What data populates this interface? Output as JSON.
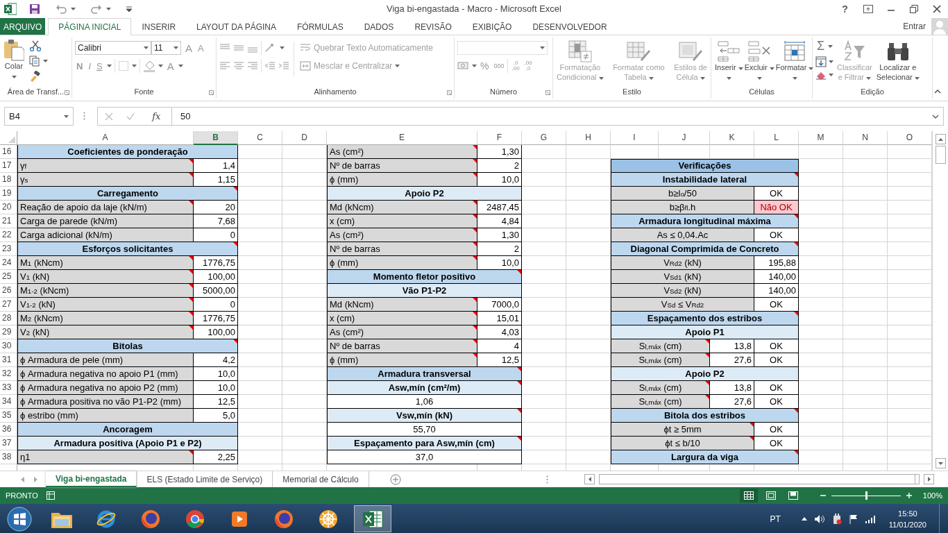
{
  "window": {
    "title": "Viga bi-engastada - Macro - Microsoft Excel",
    "help": "?"
  },
  "tabs": [
    {
      "label": "ARQUIVO",
      "kind": "file",
      "selected": false
    },
    {
      "label": "PÁGINA INICIAL",
      "kind": "tab",
      "selected": true
    },
    {
      "label": "INSERIR",
      "kind": "tab",
      "selected": false
    },
    {
      "label": "LAYOUT DA PÁGINA",
      "kind": "tab",
      "selected": false
    },
    {
      "label": "FÓRMULAS",
      "kind": "tab",
      "selected": false
    },
    {
      "label": "DADOS",
      "kind": "tab",
      "selected": false
    },
    {
      "label": "REVISÃO",
      "kind": "tab",
      "selected": false
    },
    {
      "label": "EXIBIÇÃO",
      "kind": "tab",
      "selected": false
    },
    {
      "label": "DESENVOLVEDOR",
      "kind": "tab",
      "selected": false
    }
  ],
  "account": {
    "label": "Entrar"
  },
  "ribbon": {
    "clipboard": {
      "name": "Área de Transf...",
      "paste": "Colar"
    },
    "font": {
      "name": "Fonte",
      "family": "Calibri",
      "size": "11",
      "grow": "A",
      "shrink": "A",
      "bold": "N",
      "italic": "I",
      "underline": "S",
      "font_color_button": "A"
    },
    "alignment": {
      "name": "Alinhamento",
      "wrap": {
        "label": "Quebrar Texto Automaticamente",
        "disabled": true
      },
      "merge": {
        "label": "Mesclar e Centralizar",
        "disabled": true
      }
    },
    "number": {
      "name": "Número",
      "percent": "%",
      "thousands": "000",
      "decimals": [
        {
          "top": ",0",
          "bottom": ",00"
        },
        {
          "top": ",00",
          "bottom": ",0"
        }
      ]
    },
    "styles": {
      "name": "Estilo",
      "buttons": [
        {
          "lines": [
            "Formatação",
            "Condicional"
          ],
          "kind": "conditional",
          "disabled": true
        },
        {
          "lines": [
            "Formatar como",
            "Tabela"
          ],
          "kind": "table",
          "disabled": true
        },
        {
          "lines": [
            "Estilos de",
            "Célula"
          ],
          "kind": "cellstyle",
          "disabled": true
        }
      ]
    },
    "cells": {
      "name": "Células",
      "buttons": [
        {
          "label": "Inserir",
          "kind": "insert",
          "disabled": false
        },
        {
          "label": "Excluir",
          "kind": "delete",
          "disabled": false
        },
        {
          "label": "Formatar",
          "kind": "format",
          "disabled": false
        }
      ]
    },
    "editing": {
      "name": "Edição",
      "autosum": "Σ",
      "buttons": [
        {
          "lines": [
            "Classificar",
            "e Filtrar"
          ],
          "kind": "sort",
          "disabled": true
        },
        {
          "lines": [
            "Localizar e",
            "Selecionar"
          ],
          "kind": "find",
          "disabled": false
        }
      ]
    }
  },
  "formula_bar": {
    "name_box": "B4",
    "function": "fx",
    "value": "50"
  },
  "columns": [
    {
      "label": "A",
      "selected": false
    },
    {
      "label": "B",
      "selected": true
    },
    {
      "label": "C",
      "selected": false
    },
    {
      "label": "D",
      "selected": false
    },
    {
      "label": "E",
      "selected": false
    },
    {
      "label": "F",
      "selected": false
    },
    {
      "label": "G",
      "selected": false
    },
    {
      "label": "H",
      "selected": false
    },
    {
      "label": "I",
      "selected": false
    },
    {
      "label": "J",
      "selected": false
    },
    {
      "label": "K",
      "selected": false
    },
    {
      "label": "L",
      "selected": false
    },
    {
      "label": "M",
      "selected": false
    },
    {
      "label": "N",
      "selected": false
    },
    {
      "label": "O",
      "selected": false
    }
  ],
  "rows": [
    {
      "number": "16",
      "left": [
        {
          "kind": "header",
          "text": "Coeficientes de ponderação",
          "comment": false
        }
      ],
      "middle": [
        {
          "kind": "label",
          "text": "As (cm²)",
          "comment": true
        },
        {
          "kind": "value",
          "text": "1,30",
          "comment": false
        }
      ],
      "right": []
    },
    {
      "number": "17",
      "left": [
        {
          "kind": "label",
          "text": "γ$_{f}$",
          "comment": true
        },
        {
          "kind": "value",
          "text": "1,4",
          "comment": false
        }
      ],
      "middle": [
        {
          "kind": "label",
          "text": "Nº de barras",
          "comment": true
        },
        {
          "kind": "value",
          "text": "2",
          "comment": false
        }
      ],
      "right": [
        {
          "kind": "title",
          "text": "Verificações",
          "comment": false
        }
      ]
    },
    {
      "number": "18",
      "left": [
        {
          "kind": "label",
          "text": "γ$_{s}$",
          "comment": true
        },
        {
          "kind": "value",
          "text": "1,15",
          "comment": false
        }
      ],
      "middle": [
        {
          "kind": "label",
          "text": "ϕ (mm)",
          "comment": true
        },
        {
          "kind": "value",
          "text": "10,0",
          "comment": false
        }
      ],
      "right": [
        {
          "kind": "header",
          "text": "Instabilidade lateral",
          "comment": true
        }
      ]
    },
    {
      "number": "19",
      "left": [
        {
          "kind": "header",
          "text": "Carregamento",
          "comment": true
        }
      ],
      "middle": [
        {
          "kind": "subheader",
          "text": "Apoio P2",
          "comment": false
        }
      ],
      "right": [
        {
          "kind": "label",
          "text": "b≥l$_{o}$/50",
          "comment": false
        },
        {
          "kind": "status",
          "text": "OK",
          "ok": true,
          "comment": false
        }
      ]
    },
    {
      "number": "20",
      "left": [
        {
          "kind": "label",
          "text": "Reação de apoio da laje (kN/m)",
          "comment": true
        },
        {
          "kind": "value",
          "text": "20",
          "comment": false
        }
      ],
      "middle": [
        {
          "kind": "label",
          "text": "Md (kNcm)",
          "comment": true
        },
        {
          "kind": "value",
          "text": "2487,45",
          "comment": false
        }
      ],
      "right": [
        {
          "kind": "label",
          "text": "b≥β$_{fl}$.h",
          "comment": false
        },
        {
          "kind": "status",
          "text": "Não OK",
          "ok": false,
          "comment": false
        }
      ]
    },
    {
      "number": "21",
      "left": [
        {
          "kind": "label",
          "text": "Carga de parede (kN/m)",
          "comment": false
        },
        {
          "kind": "value",
          "text": "7,68",
          "comment": false
        }
      ],
      "middle": [
        {
          "kind": "label",
          "text": "x (cm)",
          "comment": true
        },
        {
          "kind": "value",
          "text": "4,84",
          "comment": false
        }
      ],
      "right": [
        {
          "kind": "header",
          "text": "Armadura longitudinal máxima",
          "comment": true
        }
      ]
    },
    {
      "number": "22",
      "left": [
        {
          "kind": "label",
          "text": "Carga adicional (kN/m)",
          "comment": false
        },
        {
          "kind": "value",
          "text": "0",
          "comment": false
        }
      ],
      "middle": [
        {
          "kind": "label",
          "text": "As (cm²)",
          "comment": true
        },
        {
          "kind": "value",
          "text": "1,30",
          "comment": false
        }
      ],
      "right": [
        {
          "kind": "label",
          "text": "As ≤ 0,04.Ac",
          "comment": false
        },
        {
          "kind": "status",
          "text": "OK",
          "ok": true,
          "comment": false
        }
      ]
    },
    {
      "number": "23",
      "left": [
        {
          "kind": "header",
          "text": "Esforços solicitantes",
          "comment": true
        }
      ],
      "middle": [
        {
          "kind": "label",
          "text": "Nº de barras",
          "comment": true
        },
        {
          "kind": "value",
          "text": "2",
          "comment": false
        }
      ],
      "right": [
        {
          "kind": "header",
          "text": "Diagonal Comprimida de Concreto",
          "comment": true
        }
      ]
    },
    {
      "number": "24",
      "left": [
        {
          "kind": "label",
          "text": "M$_{1}$ (kNcm)",
          "comment": true
        },
        {
          "kind": "value",
          "text": "1776,75",
          "comment": false
        }
      ],
      "middle": [
        {
          "kind": "label",
          "text": "ϕ (mm)",
          "comment": true
        },
        {
          "kind": "value",
          "text": "10,0",
          "comment": false
        }
      ],
      "right": [
        {
          "kind": "label",
          "text": "V$_{Rd2}$ (kN)",
          "comment": false
        },
        {
          "kind": "value",
          "text": "195,88",
          "comment": false
        }
      ]
    },
    {
      "number": "25",
      "left": [
        {
          "kind": "label",
          "text": "V$_{1}$ (kN)",
          "comment": true
        },
        {
          "kind": "value",
          "text": "100,00",
          "comment": false
        }
      ],
      "middle": [
        {
          "kind": "header",
          "text": "Momento fletor positivo",
          "comment": true
        }
      ],
      "right": [
        {
          "kind": "label",
          "text": "V$_{Sd1}$ (kN)",
          "comment": false
        },
        {
          "kind": "value",
          "text": "140,00",
          "comment": false
        }
      ]
    },
    {
      "number": "26",
      "left": [
        {
          "kind": "label",
          "text": "M$_{1-2}$ (kNcm)",
          "comment": true
        },
        {
          "kind": "value",
          "text": "5000,00",
          "comment": false
        }
      ],
      "middle": [
        {
          "kind": "subheader",
          "text": "Vão P1-P2",
          "comment": false
        }
      ],
      "right": [
        {
          "kind": "label",
          "text": "V$_{Sd2}$ (kN)",
          "comment": false
        },
        {
          "kind": "value",
          "text": "140,00",
          "comment": false
        }
      ]
    },
    {
      "number": "27",
      "left": [
        {
          "kind": "label",
          "text": "V$_{1-2}$ (kN)",
          "comment": true
        },
        {
          "kind": "value",
          "text": "0",
          "comment": false
        }
      ],
      "middle": [
        {
          "kind": "label",
          "text": "Md (kNcm)",
          "comment": true
        },
        {
          "kind": "value",
          "text": "7000,0",
          "comment": false
        }
      ],
      "right": [
        {
          "kind": "label",
          "text": "V$_{Sd}$ ≤ V$_{Rd2}$",
          "comment": false
        },
        {
          "kind": "status",
          "text": "OK",
          "ok": true,
          "comment": false
        }
      ]
    },
    {
      "number": "28",
      "left": [
        {
          "kind": "label",
          "text": "M$_{2}$ (kNcm)",
          "comment": true
        },
        {
          "kind": "value",
          "text": "1776,75",
          "comment": false
        }
      ],
      "middle": [
        {
          "kind": "label",
          "text": "x (cm)",
          "comment": true
        },
        {
          "kind": "value",
          "text": "15,01",
          "comment": false
        }
      ],
      "right": [
        {
          "kind": "header",
          "text": "Espaçamento dos estribos",
          "comment": true
        }
      ]
    },
    {
      "number": "29",
      "left": [
        {
          "kind": "label",
          "text": "V$_{2}$ (kN)",
          "comment": true
        },
        {
          "kind": "value",
          "text": "100,00",
          "comment": false
        }
      ],
      "middle": [
        {
          "kind": "label",
          "text": "As (cm²)",
          "comment": true
        },
        {
          "kind": "value",
          "text": "4,03",
          "comment": false
        }
      ],
      "right": [
        {
          "kind": "subheader",
          "text": "Apoio P1",
          "comment": false
        }
      ]
    },
    {
      "number": "30",
      "left": [
        {
          "kind": "header",
          "text": "Bitolas",
          "comment": true
        }
      ],
      "middle": [
        {
          "kind": "label",
          "text": "Nº de barras",
          "comment": true
        },
        {
          "kind": "value",
          "text": "4",
          "comment": false
        }
      ],
      "right": [
        {
          "kind": "label",
          "text": "S$_{l,máx}$ (cm)",
          "comment": true
        },
        {
          "kind": "value",
          "text": "13,8",
          "comment": false
        },
        {
          "kind": "status",
          "text": "OK",
          "ok": true,
          "comment": false
        }
      ]
    },
    {
      "number": "31",
      "left": [
        {
          "kind": "label",
          "text": "ϕ Armadura de pele (mm)",
          "comment": false
        },
        {
          "kind": "value",
          "text": "4,2",
          "comment": false
        }
      ],
      "middle": [
        {
          "kind": "label",
          "text": "ϕ (mm)",
          "comment": true
        },
        {
          "kind": "value",
          "text": "12,5",
          "comment": false
        }
      ],
      "right": [
        {
          "kind": "label",
          "text": "S$_{t,máx}$ (cm)",
          "comment": true
        },
        {
          "kind": "value",
          "text": "27,6",
          "comment": false
        },
        {
          "kind": "status",
          "text": "OK",
          "ok": true,
          "comment": false
        }
      ]
    },
    {
      "number": "32",
      "left": [
        {
          "kind": "label",
          "text": "ϕ Armadura negativa no apoio P1 (mm)",
          "comment": false
        },
        {
          "kind": "value",
          "text": "10,0",
          "comment": false
        }
      ],
      "middle": [
        {
          "kind": "header",
          "text": "Armadura transversal",
          "comment": true
        }
      ],
      "right": [
        {
          "kind": "subheader",
          "text": "Apoio P2",
          "comment": false
        }
      ]
    },
    {
      "number": "33",
      "left": [
        {
          "kind": "label",
          "text": "ϕ Armadura negativa no apoio P2 (mm)",
          "comment": false
        },
        {
          "kind": "value",
          "text": "10,0",
          "comment": false
        }
      ],
      "middle": [
        {
          "kind": "subheader",
          "text": "Asw,mín (cm²/m)",
          "comment": true
        }
      ],
      "right": [
        {
          "kind": "label",
          "text": "S$_{l,máx}$ (cm)",
          "comment": true
        },
        {
          "kind": "value",
          "text": "13,8",
          "comment": false
        },
        {
          "kind": "status",
          "text": "OK",
          "ok": true,
          "comment": false
        }
      ]
    },
    {
      "number": "34",
      "left": [
        {
          "kind": "label",
          "text": "ϕ Armadura positiva no vão P1-P2 (mm)",
          "comment": false
        },
        {
          "kind": "value",
          "text": "12,5",
          "comment": false
        }
      ],
      "middle": [
        {
          "kind": "center",
          "text": "1,06",
          "comment": false
        }
      ],
      "right": [
        {
          "kind": "label",
          "text": "S$_{t,máx}$ (cm)",
          "comment": true
        },
        {
          "kind": "value",
          "text": "27,6",
          "comment": false
        },
        {
          "kind": "status",
          "text": "OK",
          "ok": true,
          "comment": false
        }
      ]
    },
    {
      "number": "35",
      "left": [
        {
          "kind": "label",
          "text": "ϕ estribo (mm)",
          "comment": false
        },
        {
          "kind": "value",
          "text": "5,0",
          "comment": false
        }
      ],
      "middle": [
        {
          "kind": "subheader",
          "text": "Vsw,mín (kN)",
          "comment": true
        }
      ],
      "right": [
        {
          "kind": "header",
          "text": "Bitola dos estribos",
          "comment": true
        }
      ]
    },
    {
      "number": "36",
      "left": [
        {
          "kind": "header",
          "text": "Ancoragem",
          "comment": false
        }
      ],
      "middle": [
        {
          "kind": "center",
          "text": "55,70",
          "comment": false
        }
      ],
      "right": [
        {
          "kind": "label",
          "text": "ϕt ≥ 5mm",
          "comment": true
        },
        {
          "kind": "status",
          "text": "OK",
          "ok": true,
          "comment": false
        }
      ]
    },
    {
      "number": "37",
      "left": [
        {
          "kind": "subheader",
          "text": "Armadura positiva (Apoio P1 e P2)",
          "comment": false
        }
      ],
      "middle": [
        {
          "kind": "subheader",
          "text": "Espaçamento para Asw,mín (cm)",
          "comment": true
        }
      ],
      "right": [
        {
          "kind": "label",
          "text": "ϕt ≤ b/10",
          "comment": true
        },
        {
          "kind": "status",
          "text": "OK",
          "ok": true,
          "comment": false
        }
      ]
    },
    {
      "number": "38",
      "left": [
        {
          "kind": "label",
          "text": "η1",
          "comment": true
        },
        {
          "kind": "value",
          "text": "2,25",
          "comment": false
        }
      ],
      "middle": [
        {
          "kind": "center",
          "text": "37,0",
          "comment": false
        }
      ],
      "right": [
        {
          "kind": "header",
          "text": "Largura da viga",
          "comment": true
        }
      ]
    }
  ],
  "sheets": [
    {
      "label": "Viga bi-engastada",
      "selected": true
    },
    {
      "label": "ELS (Estado Limite de Serviço)",
      "selected": false
    },
    {
      "label": "Memorial de Cálculo",
      "selected": false
    }
  ],
  "status_bar": {
    "label": "PRONTO",
    "views": [
      {
        "kind": "normal",
        "selected": true
      },
      {
        "kind": "layout",
        "selected": false
      },
      {
        "kind": "pagebreak",
        "selected": false
      }
    ],
    "zoom": {
      "level": 0.5,
      "label": "100%"
    }
  },
  "taskbar": {
    "apps": [
      {
        "kind": "folder",
        "active": false
      },
      {
        "kind": "browser_e",
        "active": false
      },
      {
        "kind": "browser_fox",
        "active": false
      },
      {
        "kind": "browser_ring",
        "active": false
      },
      {
        "kind": "media",
        "active": false
      },
      {
        "kind": "browser_fox",
        "active": false
      },
      {
        "kind": "wheel",
        "active": false
      },
      {
        "kind": "spreadsheet",
        "active": true
      }
    ],
    "language": "PT",
    "time": "15:50",
    "date": "11/01/2020"
  }
}
